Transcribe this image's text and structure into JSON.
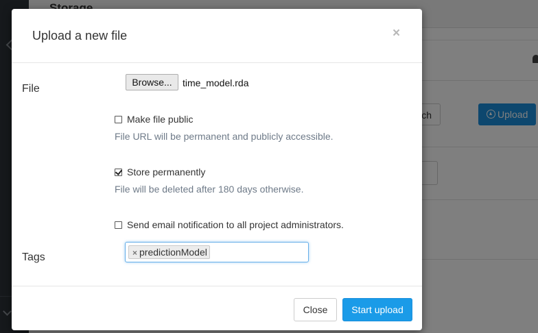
{
  "background": {
    "page_title": "Storage",
    "search_button_label": "ch",
    "upload_button_label": "Upload"
  },
  "modal": {
    "title": "Upload a new file",
    "close_icon": "×",
    "file_label": "File",
    "browse_label": "Browse...",
    "file_name": "time_model.rda",
    "options": [
      {
        "label": "Make file public",
        "checked": false,
        "help": "File URL will be permanent and publicly accessible."
      },
      {
        "label": "Store permanently",
        "checked": true,
        "help": "File will be deleted after 180 days otherwise."
      },
      {
        "label": "Send email notification to all project administrators.",
        "checked": false
      }
    ],
    "tags_label": "Tags",
    "tags": [
      {
        "remove_icon": "×",
        "label": "predictionModel"
      }
    ],
    "footer": {
      "close_label": "Close",
      "start_label": "Start upload"
    }
  },
  "colors": {
    "primary": "#1a9be8",
    "focus_border": "#66afe9",
    "help_text": "#6e7a88"
  }
}
